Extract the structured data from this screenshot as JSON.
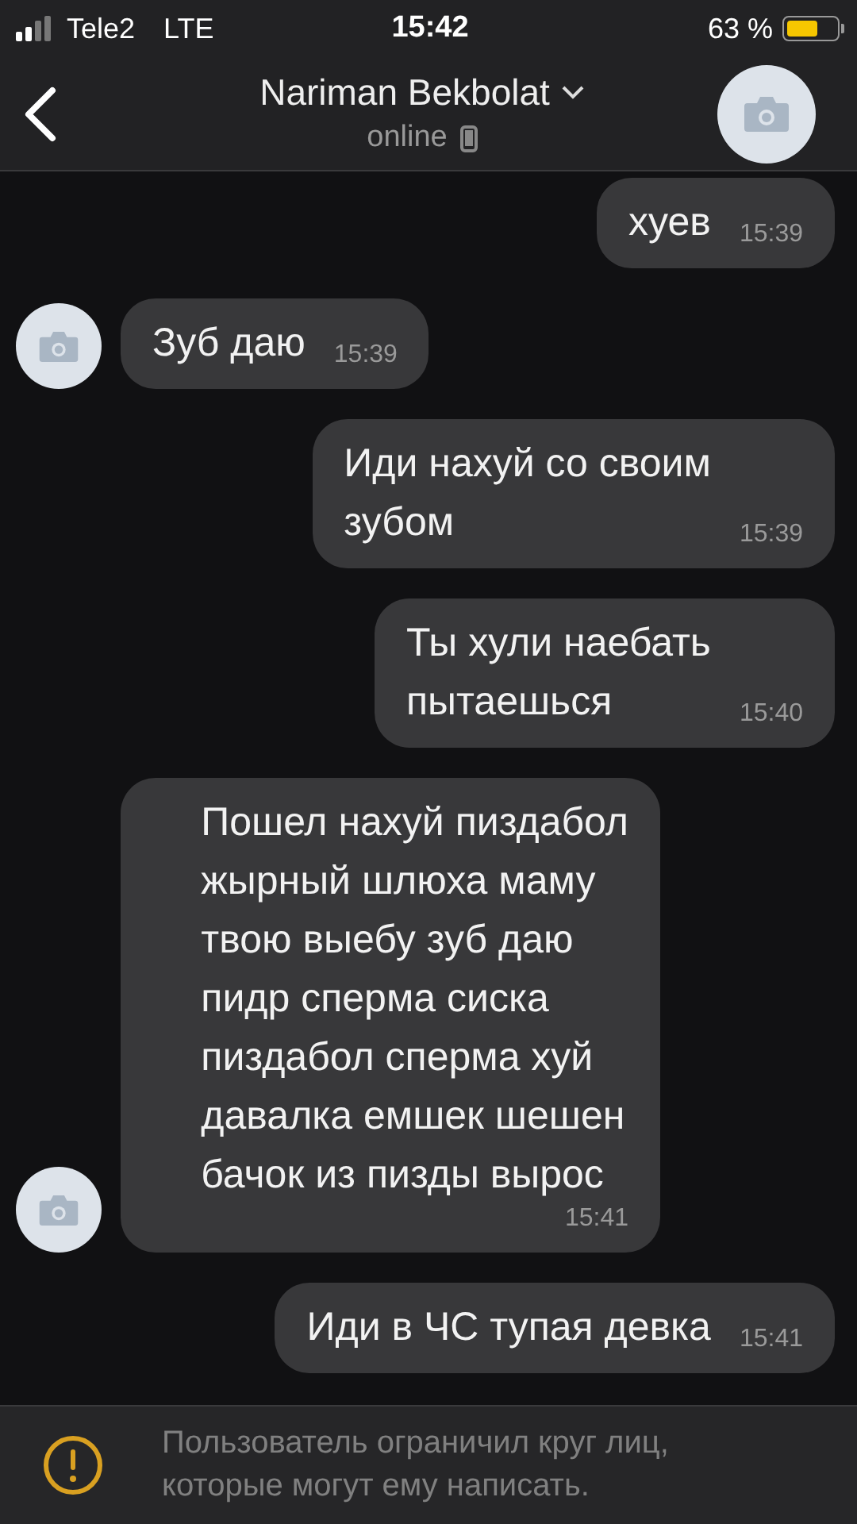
{
  "status_bar": {
    "carrier": "Tele2",
    "network": "LTE",
    "time": "15:42",
    "battery_text": "63 %"
  },
  "header": {
    "title": "Nariman Bekbolat",
    "subtitle": "online"
  },
  "messages": [
    {
      "kind": "out",
      "text": "хуев",
      "time": "15:39"
    },
    {
      "kind": "in",
      "text": "Зуб даю",
      "time": "15:39"
    },
    {
      "kind": "out",
      "text": "Иди нахуй со своим\nзубом",
      "time": "15:39"
    },
    {
      "kind": "out",
      "text": "Ты хули наебать\nпытаешься",
      "time": "15:40"
    },
    {
      "kind": "in",
      "text": "Пошел нахуй пиздабол\nжырный шлюха маму\nтвою выебу зуб даю\nпидр сперма сиска\nпиздабол сперма хуй\nдавалка емшек шешен\nбачок из пизды вырос",
      "time": "15:41"
    },
    {
      "kind": "out",
      "text": "Иди в ЧС тупая девка",
      "time": "15:41"
    }
  ],
  "notice": {
    "text": "Пользователь ограничил круг лиц,\nкоторые могут ему написать."
  }
}
